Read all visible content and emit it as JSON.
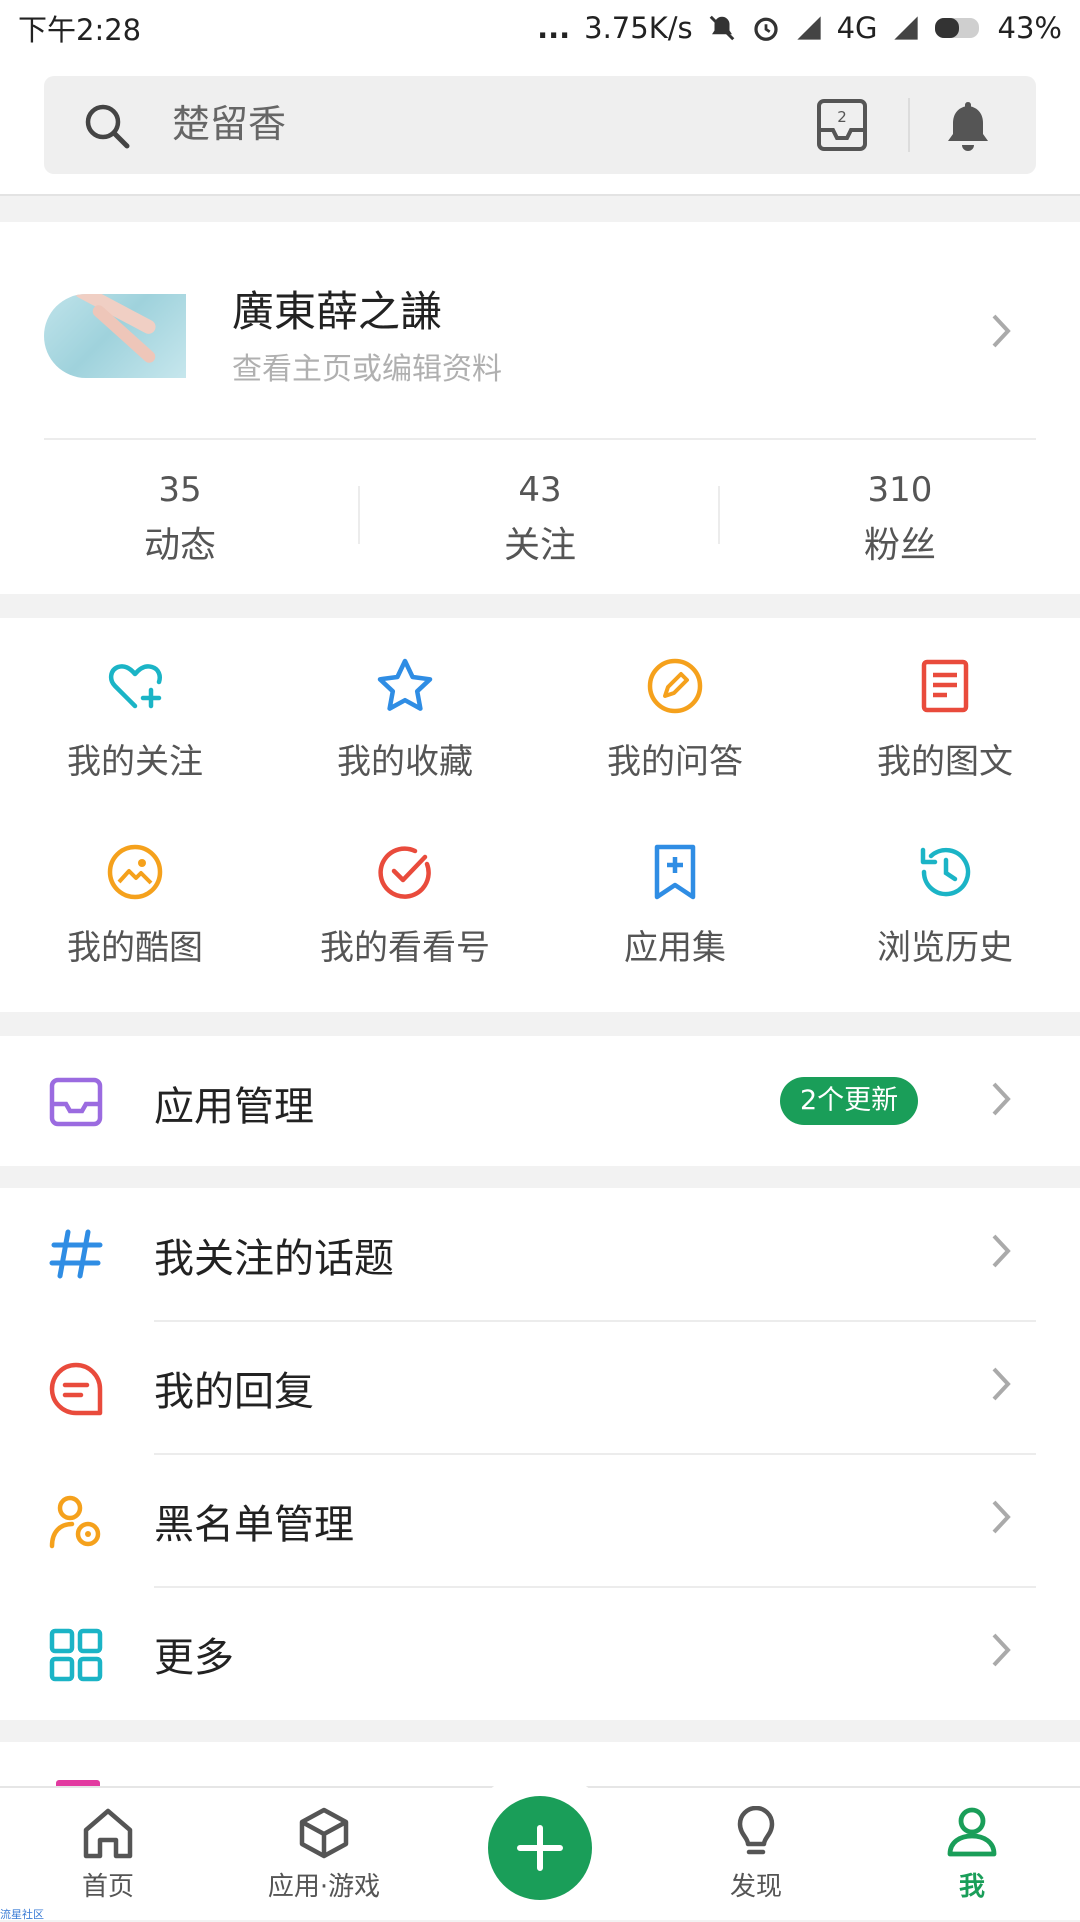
{
  "status_bar": {
    "time": "下午2:28",
    "dots": "...",
    "net_speed": "3.75K/s",
    "network": "4G",
    "battery": "43%"
  },
  "search": {
    "text": "楚留香",
    "inbox_badge": "2"
  },
  "profile": {
    "name": "廣東薛之謙",
    "subtitle": "查看主页或编辑资料",
    "stats": [
      {
        "value": "35",
        "label": "动态"
      },
      {
        "value": "43",
        "label": "关注"
      },
      {
        "value": "310",
        "label": "粉丝"
      }
    ]
  },
  "grid": [
    {
      "label": "我的关注",
      "icon": "heart-plus-icon",
      "color": "#1bb4c6"
    },
    {
      "label": "我的收藏",
      "icon": "star-icon",
      "color": "#2f8de4"
    },
    {
      "label": "我的问答",
      "icon": "pencil-circle-icon",
      "color": "#f5a11c"
    },
    {
      "label": "我的图文",
      "icon": "document-icon",
      "color": "#e94b3c"
    },
    {
      "label": "我的酷图",
      "icon": "image-circle-icon",
      "color": "#f5a11c"
    },
    {
      "label": "我的看看号",
      "icon": "check-circle-icon",
      "color": "#e94b3c"
    },
    {
      "label": "应用集",
      "icon": "bookmark-plus-icon",
      "color": "#2f8de4"
    },
    {
      "label": "浏览历史",
      "icon": "history-icon",
      "color": "#1bb4c6"
    }
  ],
  "app_manage": {
    "label": "应用管理",
    "badge": "2个更新",
    "icon": "inbox-tray-icon",
    "icon_color": "#9b6be0"
  },
  "menu": [
    {
      "label": "我关注的话题",
      "icon": "hash-icon",
      "color": "#2f8de4"
    },
    {
      "label": "我的回复",
      "icon": "chat-bubble-icon",
      "color": "#e94b3c"
    },
    {
      "label": "黑名单管理",
      "icon": "person-block-icon",
      "color": "#f5a11c"
    },
    {
      "label": "更多",
      "icon": "grid-icon",
      "color": "#1bb4c6"
    }
  ],
  "bottom_nav": [
    {
      "label": "首页",
      "icon": "home-icon"
    },
    {
      "label": "应用·游戏",
      "icon": "cube-icon"
    },
    {
      "label": "发现",
      "icon": "lightbulb-icon"
    },
    {
      "label": "我",
      "icon": "person-icon",
      "active": true
    }
  ],
  "accent_color": "#1a9e59",
  "watermark": "流星社区"
}
